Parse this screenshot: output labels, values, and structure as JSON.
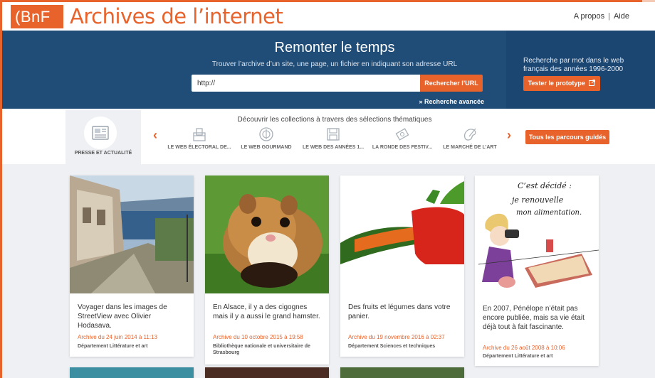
{
  "header": {
    "logo": "(BnF",
    "title": "Archives de l’internet",
    "links": [
      "A propos",
      "Aide"
    ],
    "separator": "|"
  },
  "search": {
    "title": "Remonter le temps",
    "subtitle": "Trouver l’archive d’un site, une page, un fichier en indiquant son adresse URL",
    "url_value": "http://",
    "button": "Rechercher l’URL",
    "advanced": "» Recherche avancée"
  },
  "prototype": {
    "text": "Recherche par mot dans le web français des années 1996-2000",
    "button": "Tester le prototype"
  },
  "collections": {
    "heading": "Découvrir les collections à travers des sélections thématiques",
    "active": {
      "label": "PRESSE ET ACTUALITÉ",
      "icon": "newspaper-icon"
    },
    "items": [
      {
        "label": "LE WEB ÉLECTORAL DE...",
        "icon": "ballot-box-icon"
      },
      {
        "label": "LE WEB GOURMAND",
        "icon": "plate-icon"
      },
      {
        "label": "LE WEB DES ANNÉES 1...",
        "icon": "floppy-disk-icon"
      },
      {
        "label": "LA RONDE DES FESTIV...",
        "icon": "film-icon"
      },
      {
        "label": "LE MARCHÉ DE L’ART",
        "icon": "palette-icon"
      }
    ],
    "all_button": "Tous les parcours guidés"
  },
  "cards": [
    {
      "text": "Voyager dans les images de StreetView avec Olivier Hodasava.",
      "date": "Archive du 24 juin 2014 à 11:13",
      "dept": "Département Littérature et art"
    },
    {
      "text": "En Alsace, il y a des cigognes mais il y a aussi le grand hamster.",
      "date": "Archive du 10 octobre 2015 à 19:58",
      "dept": "Bibliothèque nationale et universitaire de Strasbourg"
    },
    {
      "text": "Des fruits et légumes dans votre panier.",
      "date": "Archive du 19 novembre 2016 à 02:37",
      "dept": "Département Sciences et techniques"
    },
    {
      "text": "En 2007, Pénélope n’était pas encore publiée, mais sa vie était déjà tout à fait fascinante.",
      "date": "Archive du 26 août 2008 à 10:06",
      "dept": "Département Littérature et art",
      "handwriting": [
        "C’est décidé :",
        "je renouvelle",
        "mon alimentation."
      ]
    }
  ],
  "colors": {
    "accent": "#e8622b",
    "banner": "#1f4d78"
  }
}
